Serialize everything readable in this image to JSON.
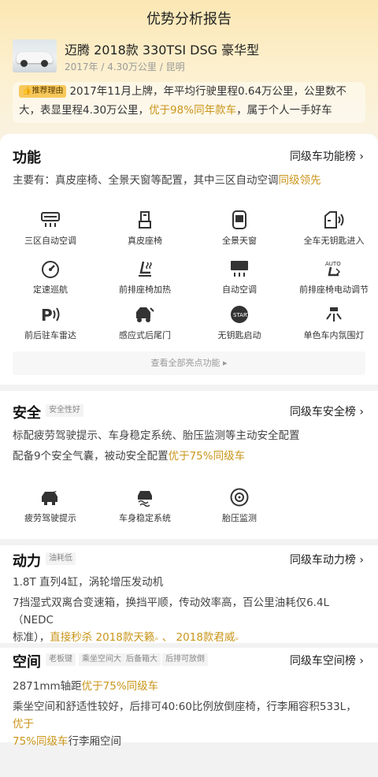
{
  "page": {
    "title": "优势分析报告"
  },
  "car": {
    "name": "迈腾 2018款 330TSI DSG 豪华型",
    "meta": "2017年 / 4.30万公里 / 昆明",
    "thumbnail_icon": "car-photo"
  },
  "recommend": {
    "badge": "推荐理由",
    "text_before": "2017年11月上牌，年平均行驶里程0.64万公里，公里数不大，表显里程4.30万公里，",
    "highlight": "优于98%同年款车",
    "text_after": "，属于个人一手好车"
  },
  "features": {
    "title": "功能",
    "link": "同级车功能榜",
    "summary_before": "主要有：真皮座椅、全景天窗等配置，其中三区自动空调",
    "summary_highlight": "同级领先",
    "items": [
      {
        "label": "三区自动空调",
        "icon": "climate-control-icon"
      },
      {
        "label": "真皮座椅",
        "icon": "leather-seat-icon"
      },
      {
        "label": "全景天窗",
        "icon": "sunroof-icon"
      },
      {
        "label": "全车无钥匙进入",
        "icon": "keyless-entry-icon"
      },
      {
        "label": "定速巡航",
        "icon": "cruise-control-icon"
      },
      {
        "label": "前排座椅加热",
        "icon": "seat-heating-icon"
      },
      {
        "label": "自动空调",
        "icon": "auto-ac-icon"
      },
      {
        "label": "前排座椅电动调节",
        "icon": "power-seat-icon"
      },
      {
        "label": "前后驻车雷达",
        "icon": "parking-radar-icon"
      },
      {
        "label": "感应式后尾门",
        "icon": "tailgate-icon"
      },
      {
        "label": "无钥匙启动",
        "icon": "keyless-start-icon"
      },
      {
        "label": "单色车内氛围灯",
        "icon": "ambient-light-icon"
      }
    ],
    "more": "查看全部亮点功能"
  },
  "safety": {
    "title": "安全",
    "tag": "安全性好",
    "link": "同级车安全榜",
    "line1": "标配疲劳驾驶提示、车身稳定系统、胎压监测等主动安全配置",
    "line2_before": "配备9个安全气囊，被动安全配置",
    "line2_highlight": "优于75%同级车",
    "items": [
      {
        "label": "疲劳驾驶提示",
        "icon": "fatigue-alert-icon"
      },
      {
        "label": "车身稳定系统",
        "icon": "stability-control-icon"
      },
      {
        "label": "胎压监测",
        "icon": "tire-pressure-icon"
      }
    ]
  },
  "power": {
    "title": "动力",
    "tag": "油耗低",
    "link": "同级车动力榜",
    "line1": "1.8T 直列4缸，涡轮增压发动机",
    "line2_a": "7挡湿式双离合变速箱，换挡平顺，传动效率高，百公里油耗仅6.4L（NEDC",
    "line2_b_before": "标准），",
    "line2_b_highlight1": "直接秒杀 2018款天籁",
    "line2_b_sep": " 、 ",
    "line2_b_highlight2": "2018款君威"
  },
  "space": {
    "title": "空间",
    "tags": [
      "老板键",
      "乘坐空间大",
      "后备箱大",
      "后排可放倒"
    ],
    "link": "同级车空间榜",
    "line1_before": "2871mm轴距",
    "line1_highlight": "优于75%同级车",
    "line2_a_before": "乘坐空间和舒适性较好，后排可40:60比例放倒座椅，行李厢容积533L，",
    "line2_a_highlight": "优于",
    "line2_b_highlight": "75%同级车",
    "line2_b_after": "行李厢空间"
  },
  "colors": {
    "accent": "#c9961b",
    "header_bg": "#fbe7b3",
    "badge_bg": "#f7c85b"
  }
}
